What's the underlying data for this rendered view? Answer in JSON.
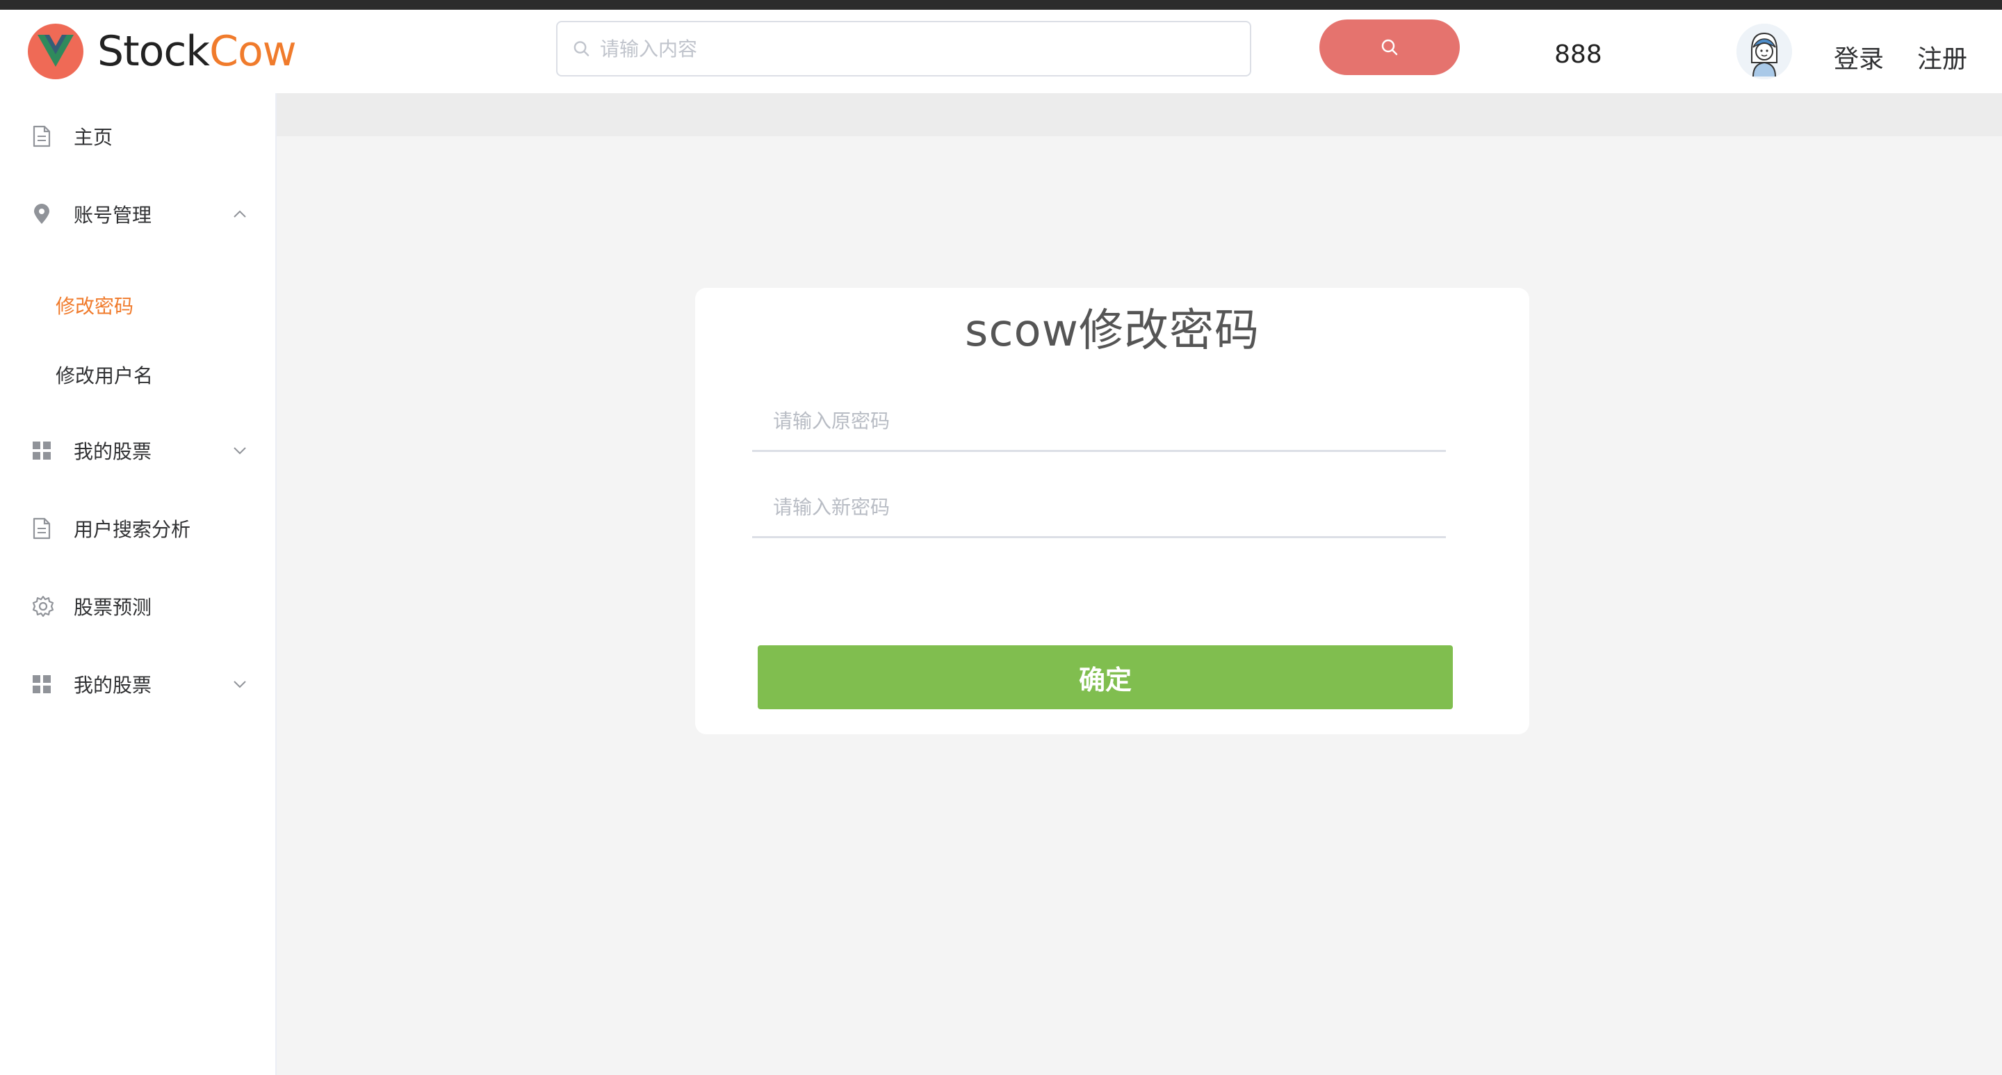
{
  "brand": {
    "name_part1": "Stock",
    "name_part2": "Cow",
    "accent": "#f07b2c",
    "logo_color": "#ef6a56"
  },
  "header": {
    "search_placeholder": "请输入内容",
    "search_button_icon": "search-icon",
    "count": "888",
    "login_label": "登录",
    "register_label": "注册"
  },
  "sidebar": {
    "items": [
      {
        "label": "主页",
        "icon": "document-icon"
      },
      {
        "label": "账号管理",
        "icon": "location-icon",
        "expanded": true,
        "children": [
          {
            "label": "修改密码",
            "active": true
          },
          {
            "label": "修改用户名"
          }
        ]
      },
      {
        "label": "我的股票",
        "icon": "grid-icon",
        "expanded": false
      },
      {
        "label": "用户搜索分析",
        "icon": "document-icon"
      },
      {
        "label": "股票预测",
        "icon": "gear-icon"
      },
      {
        "label": "我的股票",
        "icon": "grid-icon",
        "expanded": false
      }
    ]
  },
  "form": {
    "title": "scow修改密码",
    "old_password_placeholder": "请输入原密码",
    "new_password_placeholder": "请输入新密码",
    "confirm_label": "确定",
    "confirm_color": "#80be4f"
  }
}
